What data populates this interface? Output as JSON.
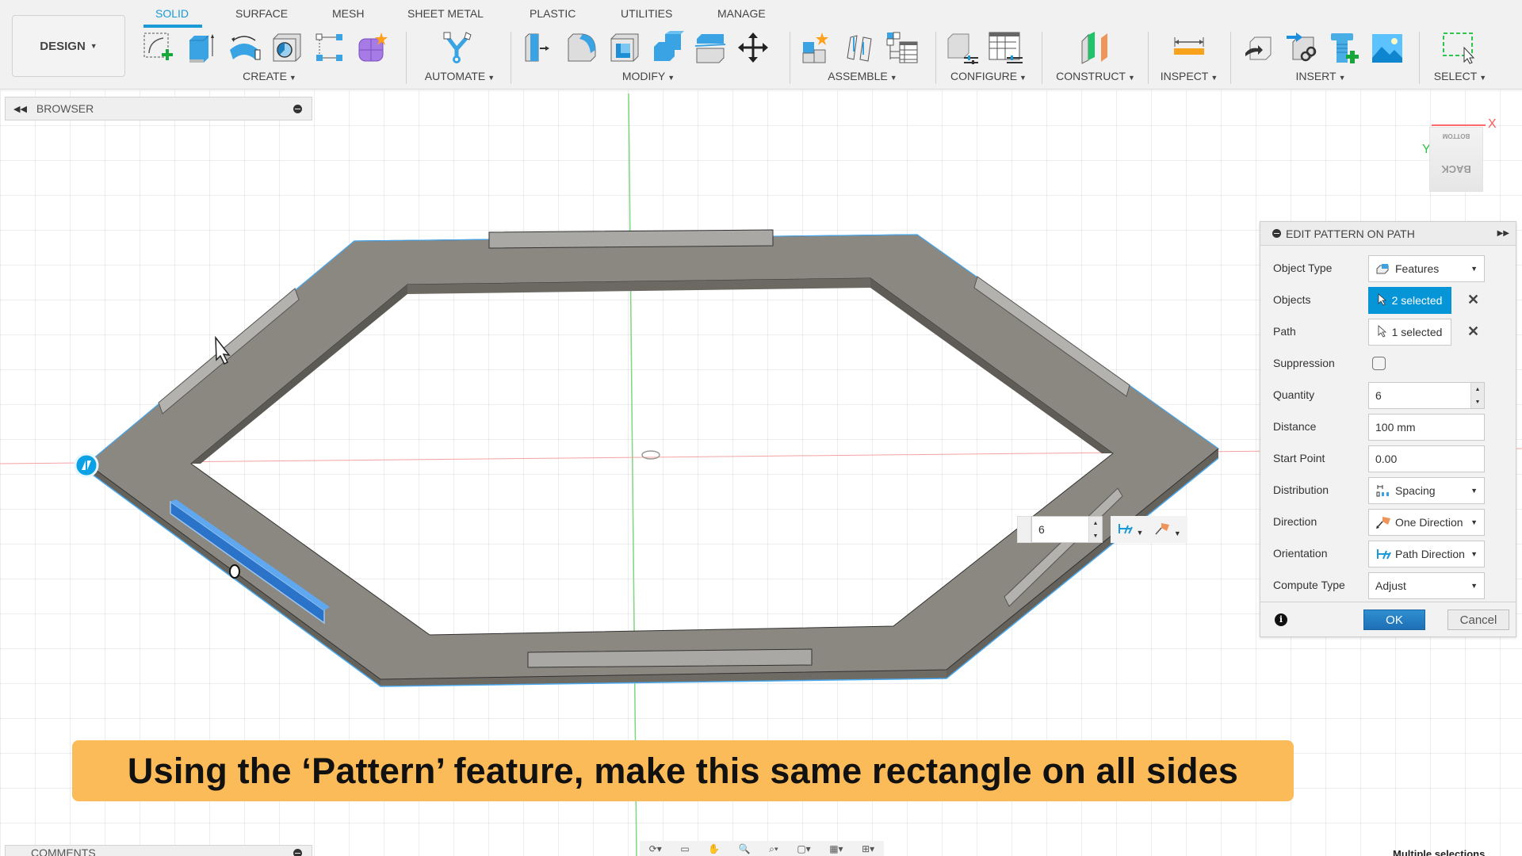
{
  "toolbar": {
    "workspace_label": "DESIGN",
    "tabs": [
      {
        "label": "SOLID",
        "active": true
      },
      {
        "label": "SURFACE"
      },
      {
        "label": "MESH"
      },
      {
        "label": "SHEET METAL"
      },
      {
        "label": "PLASTIC"
      },
      {
        "label": "UTILITIES"
      },
      {
        "label": "MANAGE"
      }
    ],
    "groups": [
      {
        "label": "CREATE",
        "icons": [
          "create-sketch-icon",
          "extrude-icon",
          "revolve-icon",
          "hole-icon",
          "pattern-icon",
          "create-form-icon"
        ]
      },
      {
        "label": "AUTOMATE",
        "icons": [
          "automate-icon"
        ]
      },
      {
        "label": "MODIFY",
        "icons": [
          "press-pull-icon",
          "fillet-icon",
          "shell-icon",
          "combine-icon",
          "split-body-icon",
          "move-icon"
        ]
      },
      {
        "label": "ASSEMBLE",
        "icons": [
          "new-component-icon",
          "joint-icon",
          "bom-table-icon"
        ]
      },
      {
        "label": "CONFIGURE",
        "icons": [
          "configure-model-icon",
          "configuration-table-icon"
        ]
      },
      {
        "label": "CONSTRUCT",
        "icons": [
          "offset-plane-icon"
        ]
      },
      {
        "label": "INSPECT",
        "icons": [
          "measure-icon"
        ]
      },
      {
        "label": "INSERT",
        "icons": [
          "insert-derive-icon",
          "insert-link-icon",
          "insert-fastener-icon",
          "insert-canvas-icon"
        ]
      },
      {
        "label": "SELECT",
        "icons": [
          "window-select-icon"
        ]
      }
    ]
  },
  "browser": {
    "title": "BROWSER"
  },
  "comments": {
    "title": "COMMENTS"
  },
  "dialog": {
    "title": "EDIT PATTERN ON PATH",
    "rows": {
      "object_type": {
        "label": "Object Type",
        "value": "Features"
      },
      "objects": {
        "label": "Objects",
        "value": "2 selected"
      },
      "path": {
        "label": "Path",
        "value": "1 selected"
      },
      "suppression": {
        "label": "Suppression",
        "checked": false
      },
      "quantity": {
        "label": "Quantity",
        "value": "6"
      },
      "distance": {
        "label": "Distance",
        "value": "100 mm"
      },
      "start_point": {
        "label": "Start Point",
        "value": "0.00"
      },
      "distribution": {
        "label": "Distribution",
        "value": "Spacing"
      },
      "direction": {
        "label": "Direction",
        "value": "One Direction"
      },
      "orientation": {
        "label": "Orientation",
        "value": "Path Direction"
      },
      "compute_type": {
        "label": "Compute Type",
        "value": "Adjust"
      }
    },
    "ok_label": "OK",
    "cancel_label": "Cancel"
  },
  "viewport": {
    "quantity_input": "6",
    "viewcube": {
      "top_face": "BOTTOM",
      "front_face": "BACK",
      "x_label": "X",
      "y_label": "Y"
    }
  },
  "status": {
    "text": "Multiple selections"
  },
  "caption": {
    "text": "Using the ‘Pattern’ feature, make this same rectangle on all sides"
  },
  "colors": {
    "accent": "#0696d7",
    "banner": "#fbbb58",
    "body": "#8a8781",
    "selected_feature": "#2b73c9"
  }
}
